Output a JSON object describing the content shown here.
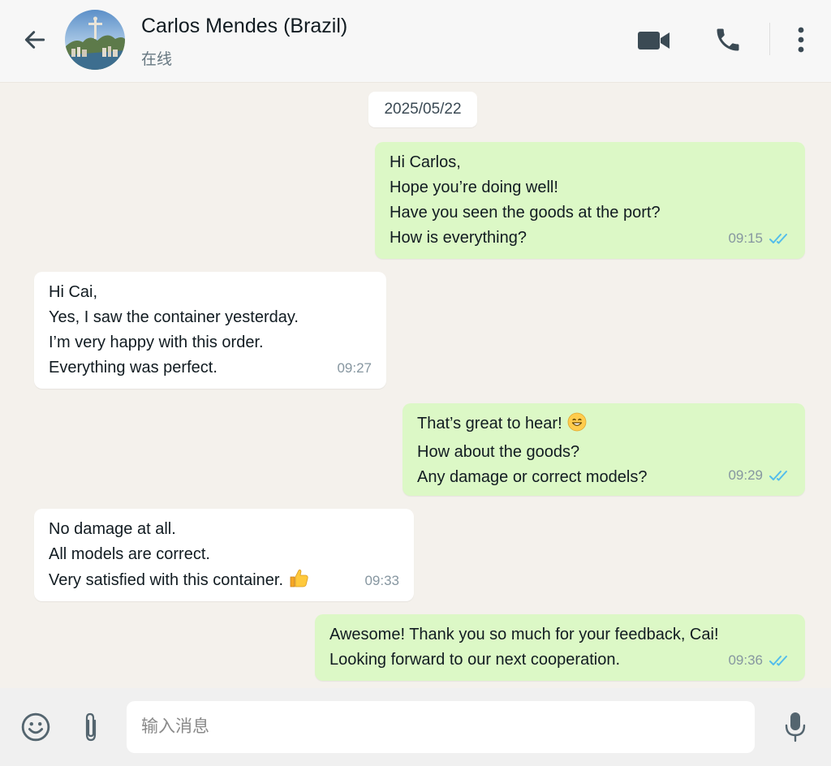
{
  "header": {
    "contact_name": "Carlos Mendes (Brazil)",
    "status": "在线",
    "icons": {
      "back": "arrow-left-icon",
      "video": "video-camera-icon",
      "call": "phone-icon",
      "menu": "more-vertical-icon"
    }
  },
  "chat": {
    "date": "2025/05/22",
    "messages": [
      {
        "direction": "outgoing",
        "lines": [
          "Hi Carlos,",
          "Hope you’re doing well!",
          "Have you seen the goods at the port?",
          "How is everything?"
        ],
        "time": "09:15",
        "read": true
      },
      {
        "direction": "incoming",
        "lines": [
          "Hi Cai,",
          "Yes, I saw the container yesterday.",
          "I’m very happy with this order.",
          "Everything was perfect."
        ],
        "time": "09:27"
      },
      {
        "direction": "outgoing",
        "lines": [
          "That’s great to hear!",
          "How about the goods?",
          "Any damage or correct models?"
        ],
        "emoji": "grinning-face-emoji",
        "time": "09:29",
        "read": true
      },
      {
        "direction": "incoming",
        "lines": [
          "No damage at all.",
          "All models are correct.",
          "Very satisfied with this container."
        ],
        "emoji": "thumbs-up-emoji",
        "time": "09:33"
      },
      {
        "direction": "outgoing",
        "lines": [
          "Awesome! Thank you so much for your feedback, Cai!",
          "Looking forward to our next cooperation."
        ],
        "time": "09:36",
        "read": true
      }
    ]
  },
  "composer": {
    "placeholder": "输入消息",
    "value": "",
    "icons": {
      "emoji": "smiley-icon",
      "attach": "paperclip-icon",
      "mic": "microphone-icon"
    }
  },
  "colors": {
    "outgoing_bubble": "#dcf8c6",
    "incoming_bubble": "#ffffff",
    "chat_background": "#f4f1ec",
    "read_tick": "#53bdeb"
  }
}
